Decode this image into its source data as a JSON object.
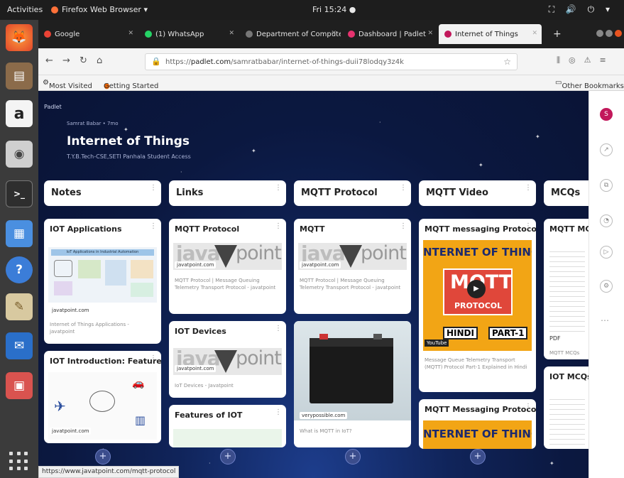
{
  "topbar": {
    "activities": "Activities",
    "app": "Firefox Web Browser ▾",
    "clock": "Fri 15:24 ●",
    "tray": "⛶ 🔊 ⏻ ▾"
  },
  "tabs": [
    {
      "label": "Google",
      "color": "#ea4335"
    },
    {
      "label": "(1) WhatsApp",
      "color": "#25d366"
    },
    {
      "label": "Department of Compute",
      "color": "#777777"
    },
    {
      "label": "Dashboard | Padlet",
      "color": "#e6326e"
    },
    {
      "label": "Internet of Things",
      "color": "#c2185b"
    }
  ],
  "nav": {
    "url_prefix": "https://",
    "url_domain": "padlet.com",
    "url_path": "/samratbabar/internet-of-things-duii78lodqy3z4k"
  },
  "bookmarks": {
    "most_visited": "Most Visited",
    "getting_started": "Getting Started",
    "other": "Other Bookmarks"
  },
  "padlet": {
    "brand": "Padlet",
    "meta": "Samrat Babar • 7mo",
    "title": "Internet of Things",
    "subtitle": "T.Y.B.Tech-CSE,SETI Panhala Student Access"
  },
  "columns": [
    "Notes",
    "Links",
    "MQTT Protocol",
    "MQTT Video",
    "MCQs"
  ],
  "cards": {
    "iot_apps": {
      "title": "IOT Applications",
      "img_caption": "IoT Applications in Industrial Automation",
      "source": "javatpoint.com",
      "caption": "Internet of Things Applications - javatpoint"
    },
    "iot_intro": {
      "title": "IOT Introduction: Features",
      "source": "javatpoint.com"
    },
    "mqtt_link": {
      "title": "MQTT Protocol",
      "source": "javatpoint.com",
      "caption": "MQTT Protocol | Message Queuing Telemetry Transport Protocol - javatpoint"
    },
    "iot_devices": {
      "title": "IOT Devices",
      "source": "javatpoint.com",
      "caption": "IoT Devices - Javatpoint"
    },
    "features": {
      "title": "Features of IOT"
    },
    "mqtt_col": {
      "title": "MQTT",
      "source": "javatpoint.com",
      "caption": "MQTT Protocol | Message Queuing Telemetry Transport Protocol - javatpoint"
    },
    "battery": {
      "source": "verypossible.com",
      "caption": "What is MQTT in IoT?"
    },
    "video1": {
      "title": "MQTT messaging Protocol",
      "banner": "NTERNET OF THING",
      "logo": "MQTT",
      "logo_sub": "PROTOCOL",
      "tag1": "HINDI",
      "tag2": "PART-1",
      "badge": "YouTube",
      "caption": "Message Queue Telemetry Transport (MQTT) Protocol Part-1 Explained in Hindi"
    },
    "video2": {
      "title": "MQTT Messaging Protocol",
      "banner": "NTERNET OF THING"
    },
    "mcq1": {
      "title": "MQTT MCQ",
      "pdf": "PDF",
      "caption": "MQTT MCQs"
    },
    "mcq2": {
      "title": "IOT MCQs"
    }
  },
  "add_button": "+",
  "statusbar": "https://www.javatpoint.com/mqtt-protocol",
  "colors": {
    "firefox_orange": "#ff7139",
    "padlet_red": "#c2185b",
    "mqtt_red": "#e0473a",
    "mqtt_yellow": "#f2a515"
  }
}
